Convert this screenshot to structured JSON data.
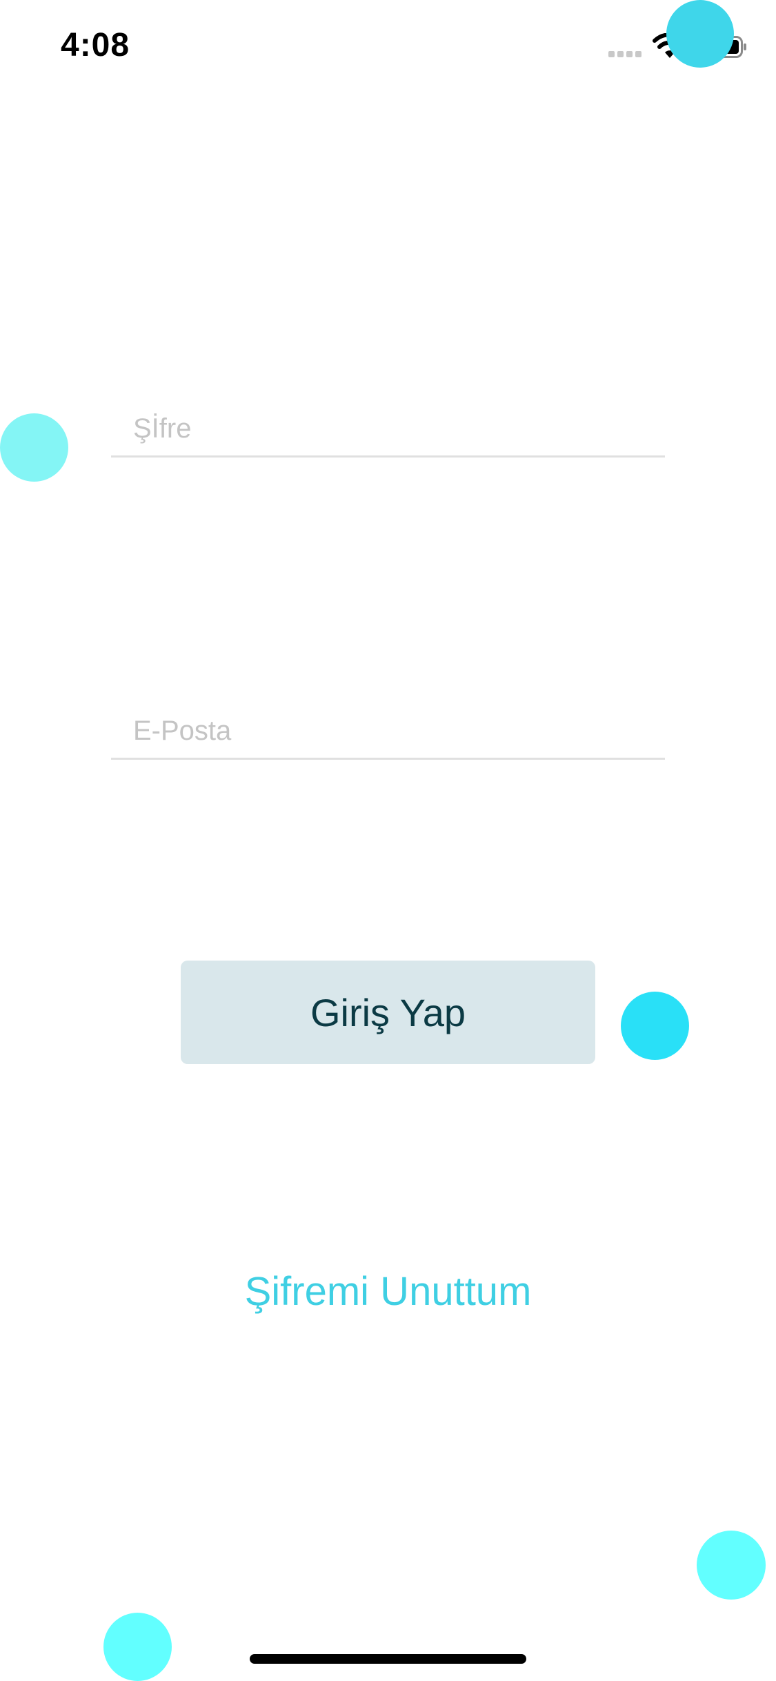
{
  "status_bar": {
    "time": "4:08"
  },
  "form": {
    "password_placeholder": "Şİfre",
    "email_placeholder": "E-Posta"
  },
  "actions": {
    "login_label": "Giriş Yap",
    "forgot_password_label": "Şifremi Unuttum"
  },
  "colors": {
    "accent": "#3fcfe3",
    "button_background": "#d9e7eb",
    "button_text": "#0b3a44",
    "placeholder": "#c4c4c4",
    "decor_circles": [
      "#3fd6ea",
      "#84f5f5",
      "#29e0f7",
      "#62ffff"
    ]
  },
  "icons": [
    "cellular-signal-icon",
    "wifi-icon",
    "battery-icon"
  ]
}
